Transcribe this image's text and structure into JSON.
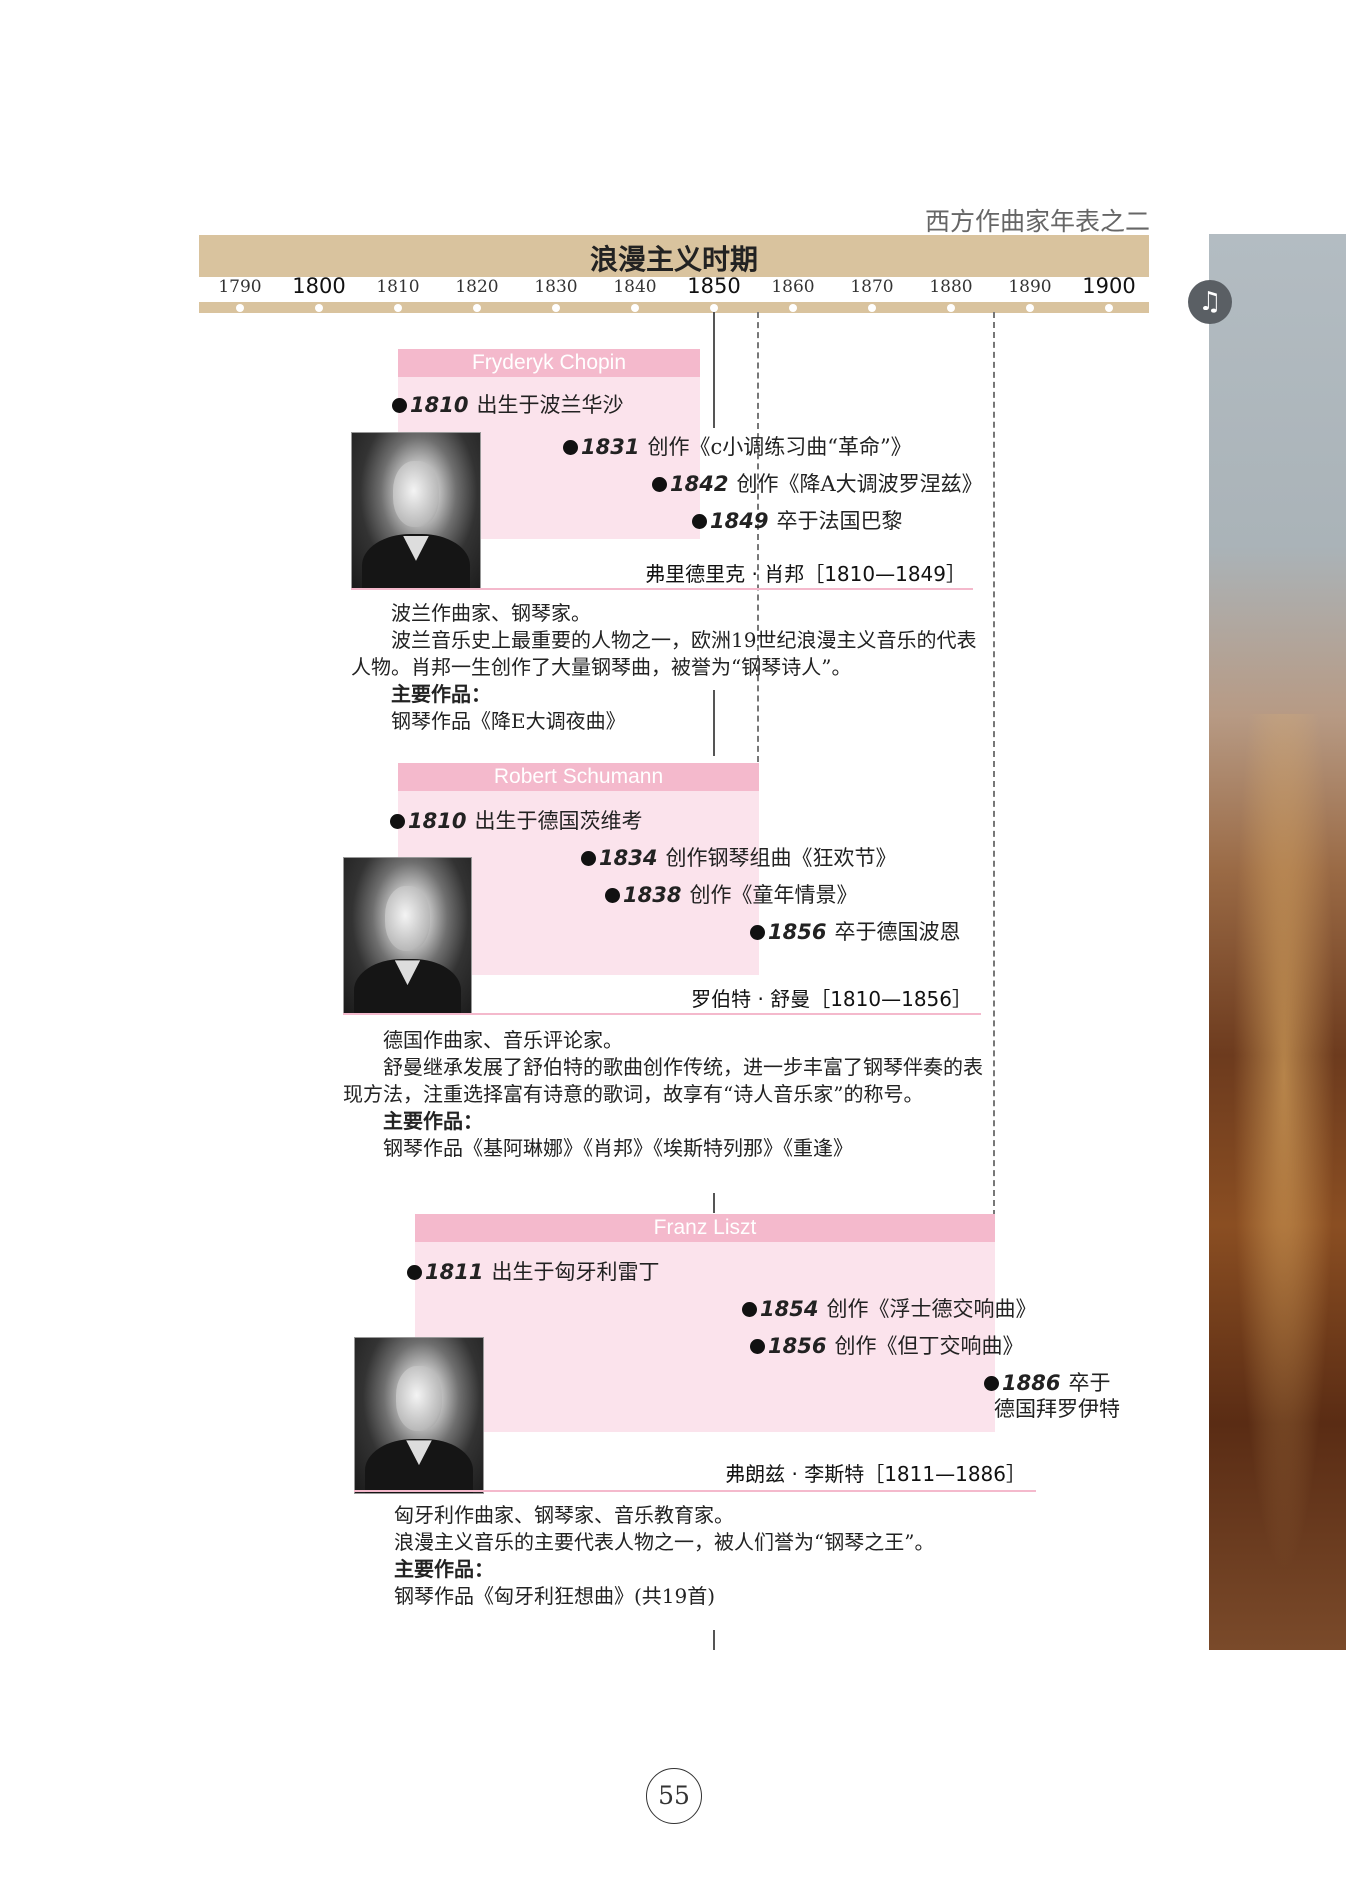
{
  "header": {
    "title": "西方作曲家年表之二"
  },
  "period": {
    "title": "浪漫主义时期"
  },
  "timeline": {
    "years": [
      {
        "label": "1790",
        "major": false
      },
      {
        "label": "1800",
        "major": true
      },
      {
        "label": "1810",
        "major": false
      },
      {
        "label": "1820",
        "major": false
      },
      {
        "label": "1830",
        "major": false
      },
      {
        "label": "1840",
        "major": false
      },
      {
        "label": "1850",
        "major": true
      },
      {
        "label": "1860",
        "major": false
      },
      {
        "label": "1870",
        "major": false
      },
      {
        "label": "1880",
        "major": false
      },
      {
        "label": "1890",
        "major": false
      },
      {
        "label": "1900",
        "major": true
      }
    ]
  },
  "icons": {
    "side_icon": "music-note-icon",
    "bullet": "bullet-dot-icon"
  },
  "colors": {
    "period_bar": "#d9c39e",
    "name_bar": "#f4b9cc",
    "pink_box": "#fbe3ec"
  },
  "composers": [
    {
      "latin_name": "Fryderyk Chopin",
      "events": [
        {
          "year": "1810",
          "text": "出生于波兰华沙"
        },
        {
          "year": "1831",
          "text": "创作《c小调练习曲“革命”》"
        },
        {
          "year": "1842",
          "text": "创作《降A大调波罗涅兹》"
        },
        {
          "year": "1849",
          "text": "卒于法国巴黎"
        }
      ],
      "chinese_name": "弗里德里克 · 肖邦［1810—1849］",
      "desc_lead": "波兰作曲家、钢琴家。",
      "desc_body": "波兰音乐史上最重要的人物之一，欧洲19世纪浪漫主义音乐的代表人物。肖邦一生创作了大量钢琴曲，被誉为“钢琴诗人”。",
      "works_title": "主要作品：",
      "works": "钢琴作品《降E大调夜曲》"
    },
    {
      "latin_name": "Robert Schumann",
      "events": [
        {
          "year": "1810",
          "text": "出生于德国茨维考"
        },
        {
          "year": "1834",
          "text": "创作钢琴组曲《狂欢节》"
        },
        {
          "year": "1838",
          "text": "创作《童年情景》"
        },
        {
          "year": "1856",
          "text": "卒于德国波恩"
        }
      ],
      "chinese_name": "罗伯特 · 舒曼［1810—1856］",
      "desc_lead": "德国作曲家、音乐评论家。",
      "desc_body": "舒曼继承发展了舒伯特的歌曲创作传统，进一步丰富了钢琴伴奏的表现方法，注重选择富有诗意的歌词，故享有“诗人音乐家”的称号。",
      "works_title": "主要作品：",
      "works": "钢琴作品《基阿琳娜》《肖邦》《埃斯特列那》《重逢》"
    },
    {
      "latin_name": "Franz Liszt",
      "events": [
        {
          "year": "1811",
          "text": "出生于匈牙利雷丁"
        },
        {
          "year": "1854",
          "text": "创作《浮士德交响曲》"
        },
        {
          "year": "1856",
          "text": "创作《但丁交响曲》"
        },
        {
          "year": "1886",
          "text": "卒于",
          "text2": "德国拜罗伊特"
        }
      ],
      "chinese_name": "弗朗兹 · 李斯特［1811—1886］",
      "desc_lead": "匈牙利作曲家、钢琴家、音乐教育家。",
      "desc_body": "浪漫主义音乐的主要代表人物之一，被人们誉为“钢琴之王”。",
      "works_title": "主要作品：",
      "works": "钢琴作品《匈牙利狂想曲》(共19首)"
    }
  ],
  "page_number": "55"
}
